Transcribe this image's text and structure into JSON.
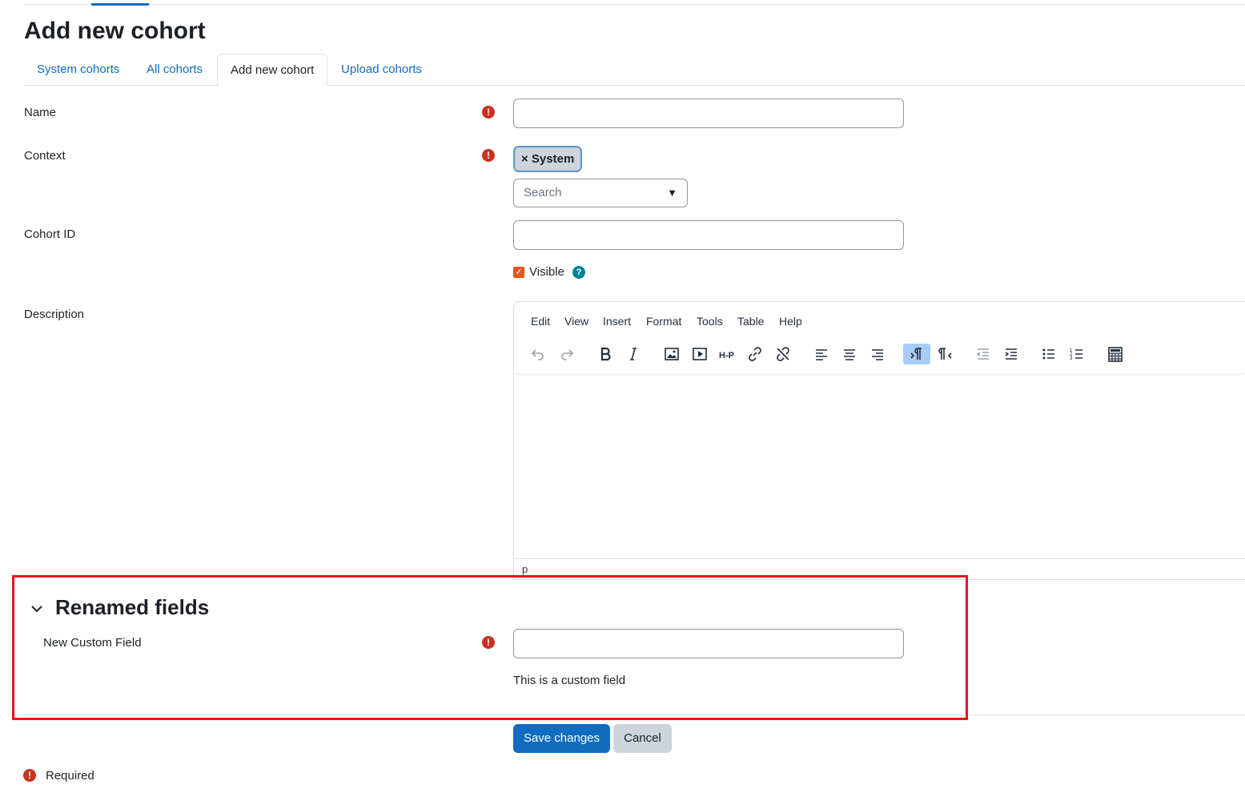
{
  "page": {
    "title": "Add new cohort"
  },
  "tabs": [
    {
      "label": "System cohorts"
    },
    {
      "label": "All cohorts"
    },
    {
      "label": "Add new cohort"
    },
    {
      "label": "Upload cohorts"
    }
  ],
  "form": {
    "name": {
      "label": "Name",
      "value": ""
    },
    "context": {
      "label": "Context",
      "chip": "× System",
      "search_placeholder": "Search",
      "caret": "▼"
    },
    "cohort_id": {
      "label": "Cohort ID",
      "value": ""
    },
    "visible": {
      "label": "Visible",
      "checked": true
    },
    "description": {
      "label": "Description",
      "menu": [
        "Edit",
        "View",
        "Insert",
        "Format",
        "Tools",
        "Table",
        "Help"
      ],
      "status_path": "p"
    }
  },
  "renamed_section": {
    "title": "Renamed fields",
    "field_label": "New Custom Field",
    "field_value": "",
    "help_text": "This is a custom field"
  },
  "buttons": {
    "save": "Save changes",
    "cancel": "Cancel"
  },
  "legend": {
    "required": "Required"
  },
  "colors": {
    "primary": "#0f6cbf",
    "required": "#ca3120",
    "help": "#008196",
    "checkbox": "#e2571a",
    "highlight": "#e8141b"
  }
}
